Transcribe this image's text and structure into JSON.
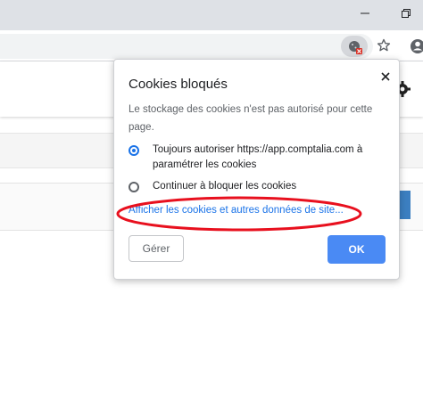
{
  "bubble": {
    "title": "Cookies bloqués",
    "description": "Le stockage des cookies n'est pas autorisé pour cette page.",
    "options": [
      {
        "label": "Toujours autoriser https://app.comptalia.com à paramétrer les cookies",
        "selected": true
      },
      {
        "label": "Continuer à bloquer les cookies",
        "selected": false
      }
    ],
    "details_link": "Afficher les cookies et autres données de site...",
    "manage_label": "Gérer",
    "ok_label": "OK"
  },
  "icons": {
    "minimize": "minimize-icon",
    "maximize": "restore-icon",
    "cookie_blocked": "cookie-blocked-icon",
    "bookmark": "star-icon",
    "profile": "profile-icon",
    "page_settings": "gear-icon",
    "close": "close-icon"
  },
  "colors": {
    "accent": "#1a73e8",
    "ok_button": "#4a8af4",
    "annotation_ellipse": "#e8101e",
    "cookie_badge": "#d93025"
  }
}
